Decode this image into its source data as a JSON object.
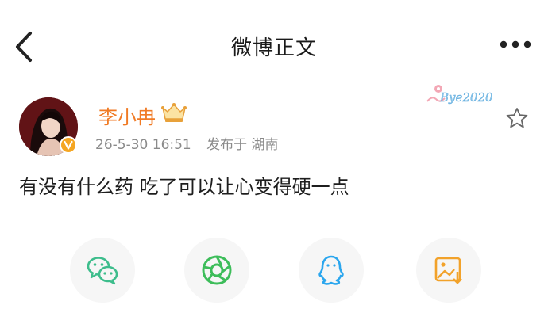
{
  "header": {
    "title": "微博正文",
    "back_icon": "chevron-left-icon",
    "more_icon": "more-dots-icon"
  },
  "post": {
    "username": "李小冉",
    "datetime": "26-5-30 16:51",
    "location_text": "发布于 湖南",
    "content": "有没有什么药 吃了可以让心变得硬一点",
    "watermark": "Bye2020"
  },
  "share": [
    {
      "name": "wechat",
      "icon": "wechat-icon",
      "color": "#3dbd8c"
    },
    {
      "name": "moments",
      "icon": "moments-icon",
      "color": "#3dbd5a"
    },
    {
      "name": "qq",
      "icon": "qq-icon",
      "color": "#2aa6ee"
    },
    {
      "name": "save-image",
      "icon": "save-image-icon",
      "color": "#f2a22a"
    }
  ],
  "colors": {
    "username": "#f07a24",
    "meta": "#8a8a8a",
    "verified_badge": "#f5a623"
  }
}
